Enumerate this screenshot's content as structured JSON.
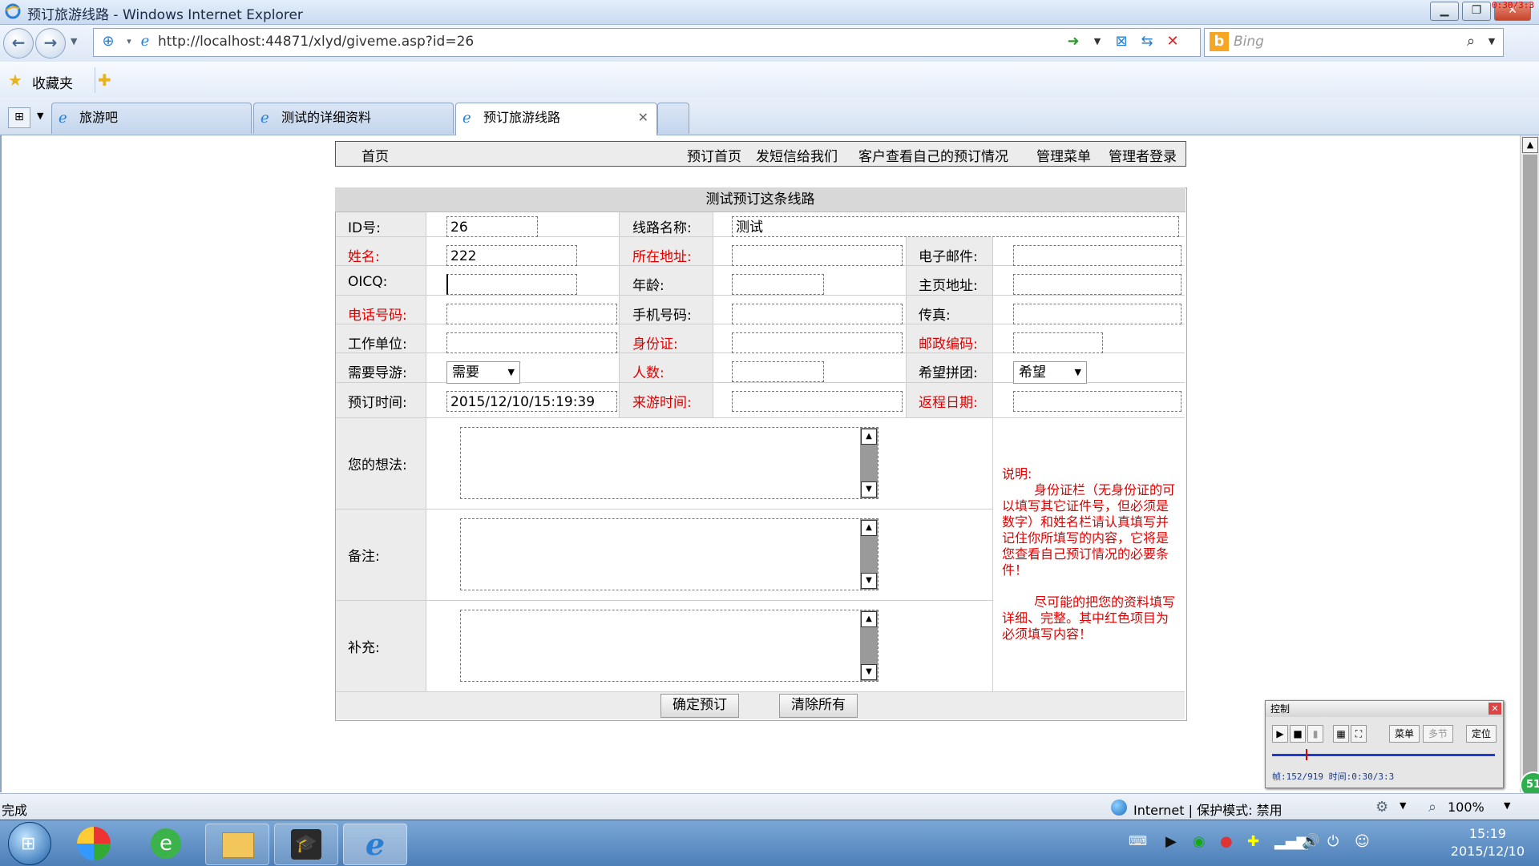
{
  "window": {
    "title": "预订旅游线路 - Windows Internet Explorer",
    "overlay_text": "0:30/3:3"
  },
  "browser": {
    "url": "http://localhost:44871/xlyd/giveme.asp?id=26",
    "search_placeholder": "Bing",
    "favorites_label": "收藏夹",
    "tabs": [
      {
        "label": "旅游吧"
      },
      {
        "label": "测试的详细资料"
      },
      {
        "label": "预订旅游线路"
      }
    ]
  },
  "nav": {
    "home": "首页",
    "items": [
      "预订首页",
      "发短信给我们",
      "客户查看自己的预订情况",
      "管理菜单",
      "管理者登录"
    ]
  },
  "form": {
    "title": "测试预订这条线路",
    "labels": {
      "id": "ID号:",
      "route_name": "线路名称:",
      "name": "姓名:",
      "address": "所在地址:",
      "email": "电子邮件:",
      "oicq": "OICQ:",
      "age": "年龄:",
      "homepage": "主页地址:",
      "phone": "电话号码:",
      "mobile": "手机号码:",
      "fax": "传真:",
      "work_unit": "工作单位:",
      "id_card": "身份证:",
      "postcode": "邮政编码:",
      "need_guide": "需要导游:",
      "people_count": "人数:",
      "hope_group": "希望拼团:",
      "booking_time": "预订时间:",
      "arrive_time": "来游时间:",
      "return_date": "返程日期:",
      "thoughts": "您的想法:",
      "remarks": "备注:",
      "supplement": "补充:"
    },
    "values": {
      "id": "26",
      "route_name": "测试",
      "name": "222",
      "address": "",
      "email": "",
      "oicq": "",
      "age": "",
      "homepage": "",
      "phone": "",
      "mobile": "",
      "fax": "",
      "work_unit": "",
      "id_card": "",
      "postcode": "",
      "need_guide": "需要",
      "people_count": "",
      "hope_group": "希望",
      "booking_time": "2015/12/10/15:19:39",
      "arrive_time": "",
      "return_date": ""
    },
    "note_title": "说明:",
    "note_p1": "身份证栏（无身份证的可以填写其它证件号，但必须是数字）和姓名栏请认真填写并记住你所填写的内容，它将是您查看自己预订情况的必要条件！",
    "note_p2": "尽可能的把您的资料填写详细、完整。其中红色项目为必须填写内容！",
    "submit_label": "确定预订",
    "clear_label": "清除所有"
  },
  "colors": {
    "required_label": "#e00000",
    "label_bg": "#ececec"
  },
  "control_panel": {
    "title": "控制",
    "menu_label": "菜单",
    "step_label": "多节",
    "locate_label": "定位",
    "status": "帧:152/919 时间:0:30/3:3"
  },
  "statusbar": {
    "left": "完成",
    "zone": "Internet | 保护模式: 禁用",
    "zoom": "100%"
  },
  "taskbar": {
    "time": "15:19",
    "date": "2015/12/10",
    "badge": "51"
  }
}
